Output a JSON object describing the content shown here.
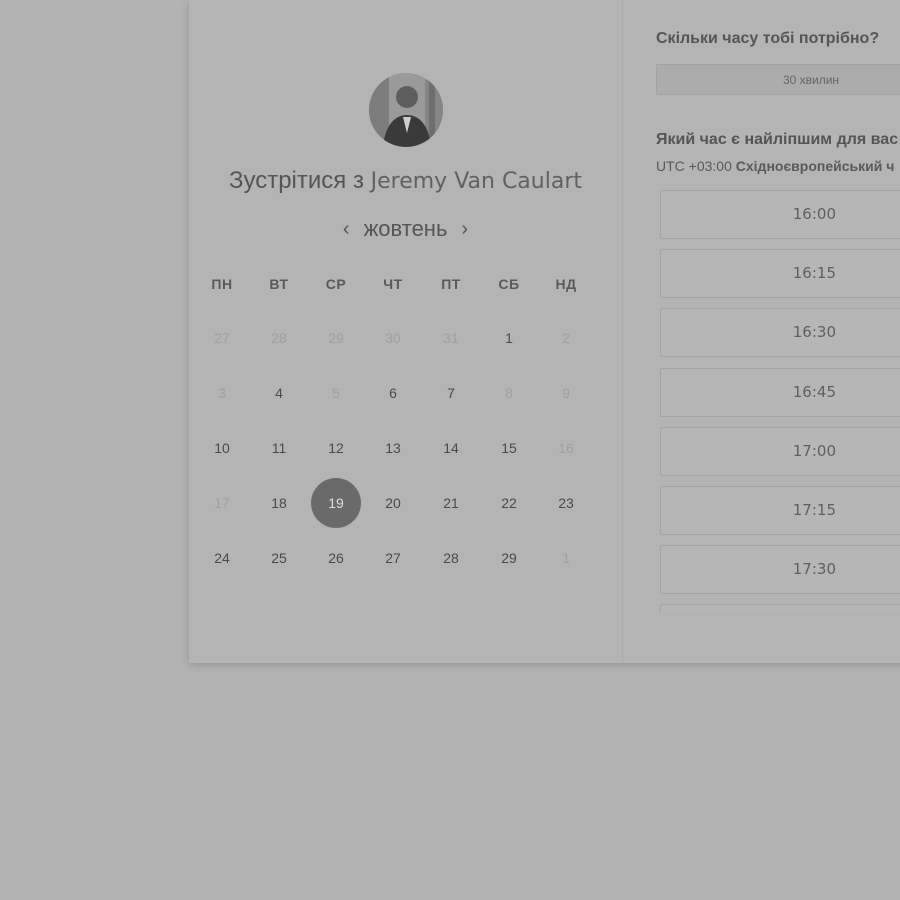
{
  "header": {
    "title_prefix": "Зустрітися з",
    "host_name": "Jeremy Van Caulart"
  },
  "calendar": {
    "prev_icon": "chevron-left-icon",
    "next_icon": "chevron-right-icon",
    "prev_label": "‹",
    "next_label": "›",
    "month": "жовтень",
    "weekdays": [
      "ПН",
      "ВТ",
      "СР",
      "ЧТ",
      "ПТ",
      "СБ",
      "НД"
    ],
    "weeks": [
      [
        {
          "d": "27",
          "muted": true
        },
        {
          "d": "28",
          "muted": true
        },
        {
          "d": "29",
          "muted": true
        },
        {
          "d": "30",
          "muted": true
        },
        {
          "d": "31",
          "muted": true
        },
        {
          "d": "1",
          "muted": false
        },
        {
          "d": "2",
          "muted": true
        }
      ],
      [
        {
          "d": "3",
          "muted": true
        },
        {
          "d": "4",
          "muted": false
        },
        {
          "d": "5",
          "muted": true
        },
        {
          "d": "6",
          "muted": false
        },
        {
          "d": "7",
          "muted": false
        },
        {
          "d": "8",
          "muted": true
        },
        {
          "d": "9",
          "muted": true
        }
      ],
      [
        {
          "d": "10",
          "muted": false
        },
        {
          "d": "11",
          "muted": false
        },
        {
          "d": "12",
          "muted": false
        },
        {
          "d": "13",
          "muted": false
        },
        {
          "d": "14",
          "muted": false
        },
        {
          "d": "15",
          "muted": false
        },
        {
          "d": "16",
          "muted": true
        }
      ],
      [
        {
          "d": "17",
          "muted": true
        },
        {
          "d": "18",
          "muted": false
        },
        {
          "d": "19",
          "muted": false,
          "selected": true
        },
        {
          "d": "20",
          "muted": false
        },
        {
          "d": "21",
          "muted": false
        },
        {
          "d": "22",
          "muted": false
        },
        {
          "d": "23",
          "muted": false
        }
      ],
      [
        {
          "d": "24",
          "muted": false
        },
        {
          "d": "25",
          "muted": false
        },
        {
          "d": "26",
          "muted": false
        },
        {
          "d": "27",
          "muted": false
        },
        {
          "d": "28",
          "muted": false
        },
        {
          "d": "29",
          "muted": false
        },
        {
          "d": "1",
          "muted": true
        }
      ]
    ]
  },
  "booking": {
    "duration_question": "Скільки часу тобі потрібно?",
    "duration_value": "30 хвилин",
    "time_question": "Який час є найліпшим для вас",
    "timezone_offset": "UTC +03:00",
    "timezone_name": "Східноєвропейський ч",
    "slots": [
      "16:00",
      "16:15",
      "16:30",
      "16:45",
      "17:00",
      "17:15",
      "17:30",
      ""
    ]
  },
  "colors": {
    "overlay": "#b3b3b3",
    "selected_day": "#6a6a6a"
  }
}
